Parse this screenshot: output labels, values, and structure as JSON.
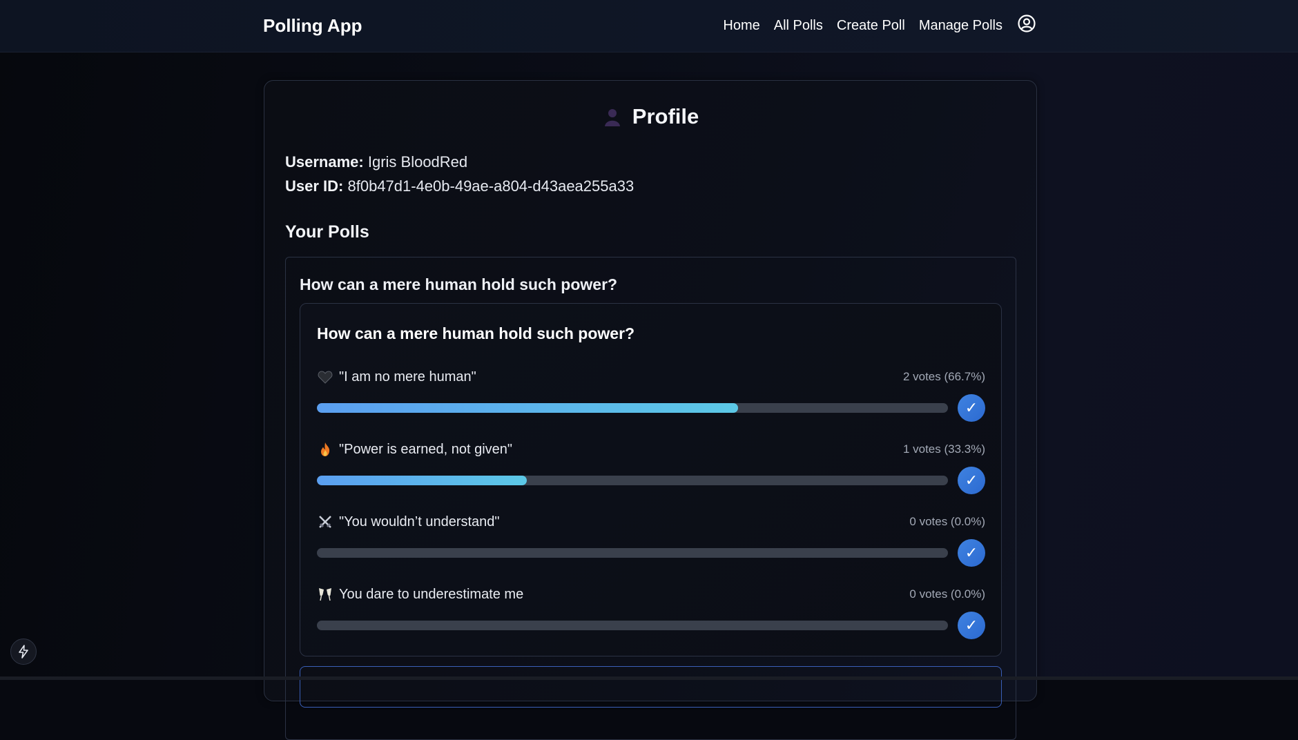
{
  "header": {
    "brand": "Polling App",
    "nav": [
      "Home",
      "All Polls",
      "Create Poll",
      "Manage Polls"
    ],
    "profile_icon": "user-circle-icon"
  },
  "profile": {
    "title": "Profile",
    "title_icon": "person-silhouette-icon",
    "username_label": "Username:",
    "username": "Igris BloodRed",
    "user_id_label": "User ID:",
    "user_id": "8f0b47d1-4e0b-49ae-a804-d43aea255a33",
    "your_polls": "Your Polls"
  },
  "poll": {
    "outer_title": "How can a mere human hold such power?",
    "title": "How can a mere human hold such power?",
    "options": [
      {
        "emoji": "black-heart-icon",
        "label": "\"I am no mere human\"",
        "votes": "2 votes (66.7%)",
        "percent": 66.7
      },
      {
        "emoji": "fire-icon",
        "label": "\"Power is earned, not given\"",
        "votes": "1 votes (33.3%)",
        "percent": 33.3
      },
      {
        "emoji": "crossed-swords-icon",
        "label": "\"You wouldn’t understand\"",
        "votes": "0 votes (0.0%)",
        "percent": 0
      },
      {
        "emoji": "clinking-glasses-icon",
        "label": "You dare to underestimate me",
        "votes": "0 votes (0.0%)",
        "percent": 0
      }
    ],
    "vote_button_glyph": "✓"
  },
  "colors": {
    "accent": "#3f82e0",
    "bar_fill_start": "#5b9ff0",
    "bar_fill_end": "#5cc8e6",
    "track": "#3a404c"
  }
}
